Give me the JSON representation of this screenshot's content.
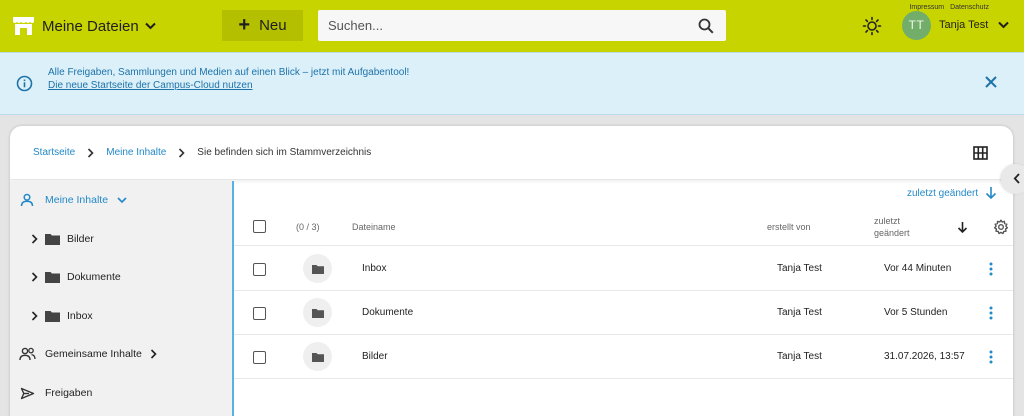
{
  "header": {
    "brand_label": "Meine Dateien",
    "new_label": "Neu",
    "search_placeholder": "Suchen...",
    "legal_links": [
      "Impressum",
      "Datenschutz"
    ],
    "user": {
      "initials": "TT",
      "name": "Tanja Test"
    }
  },
  "banner": {
    "message": "Alle Freigaben, Sammlungen und Medien auf einen Blick – jetzt mit Aufgabentool!",
    "link": "Die neue Startseite der Campus-Cloud nutzen"
  },
  "breadcrumb": {
    "items": [
      "Startseite",
      "Meine Inhalte"
    ],
    "current": "Sie befinden sich im Stammverzeichnis"
  },
  "sidebar": {
    "root": "Meine Inhalte",
    "folders": [
      "Bilder",
      "Dokumente",
      "Inbox"
    ],
    "shared": "Gemeinsame Inhalte",
    "shares": "Freigaben"
  },
  "table": {
    "sort_label": "zuletzt geändert",
    "selection_count": "(0 / 3)",
    "columns": {
      "name": "Dateiname",
      "creator": "erstellt von",
      "modified_line1": "zuletzt",
      "modified_line2": "geändert"
    },
    "rows": [
      {
        "name": "Inbox",
        "creator": "Tanja Test",
        "modified": "Vor 44 Minuten"
      },
      {
        "name": "Dokumente",
        "creator": "Tanja Test",
        "modified": "Vor 5 Stunden"
      },
      {
        "name": "Bilder",
        "creator": "Tanja Test",
        "modified": "31.07.2026, 13:57"
      }
    ]
  },
  "colors": {
    "header_bg": "#c8d400",
    "new_button_bg": "#b4bf00",
    "banner_bg": "#dcf0fa",
    "accent_blue": "#2389c9",
    "avatar_bg": "#72ae6a"
  },
  "icons": [
    "store-icon",
    "chevron-down-icon",
    "plus-icon",
    "search-icon",
    "sun-icon",
    "info-icon",
    "close-icon",
    "chevron-right-icon",
    "grid-view-icon",
    "user-icon",
    "folder-icon",
    "group-icon",
    "share-icon",
    "arrow-down-icon",
    "settings-icon",
    "kebab-menu-icon",
    "chevron-left-icon"
  ]
}
